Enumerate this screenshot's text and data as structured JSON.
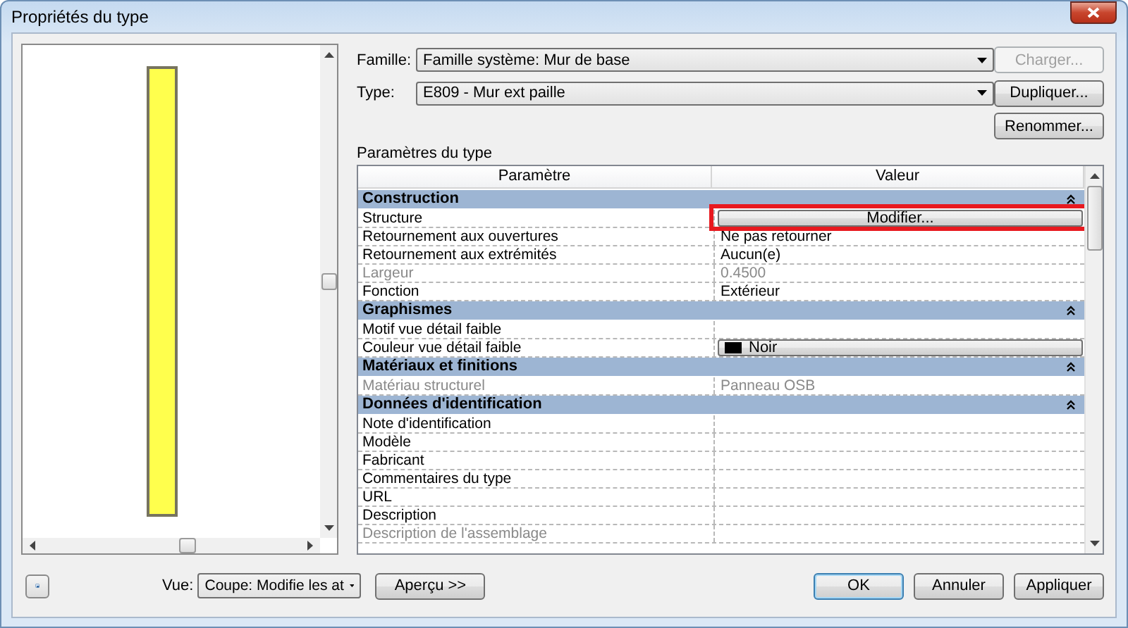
{
  "window": {
    "title": "Propriétés du type"
  },
  "family": {
    "label": "Famille:",
    "value": "Famille système: Mur de base"
  },
  "type": {
    "label": "Type:",
    "value": "E809 - Mur ext paille"
  },
  "side_buttons": [
    {
      "label": "Charger...",
      "disabled": true
    },
    {
      "label": "Dupliquer...",
      "disabled": false
    },
    {
      "label": "Renommer...",
      "disabled": false
    }
  ],
  "section_label": "Paramètres du type",
  "grid": {
    "columns": [
      "Paramètre",
      "Valeur"
    ],
    "rows": [
      {
        "kind": "group",
        "label": "Construction",
        "expanded": true
      },
      {
        "kind": "button",
        "label": "Structure",
        "value": "Modifier...",
        "highlighted": true
      },
      {
        "kind": "text",
        "label": "Retournement aux ouvertures",
        "value": "Ne pas retourner",
        "disabled": false
      },
      {
        "kind": "text",
        "label": "Retournement aux extrémités",
        "value": "Aucun(e)",
        "disabled": false
      },
      {
        "kind": "text",
        "label": "Largeur",
        "value": "0.4500",
        "disabled": true
      },
      {
        "kind": "text",
        "label": "Fonction",
        "value": "Extérieur",
        "disabled": false
      },
      {
        "kind": "group",
        "label": "Graphismes",
        "expanded": true
      },
      {
        "kind": "text",
        "label": "Motif vue détail faible",
        "disabled": false
      },
      {
        "kind": "color",
        "label": "Couleur vue détail faible",
        "value": "Noir",
        "color": "#000000"
      },
      {
        "kind": "group",
        "label": "Matériaux et finitions",
        "expanded": true
      },
      {
        "kind": "text",
        "label": "Matériau structurel",
        "value": "Panneau OSB",
        "disabled": true
      },
      {
        "kind": "group",
        "label": "Données d'identification",
        "expanded": true
      },
      {
        "kind": "text",
        "label": "Note d'identification",
        "disabled": false
      },
      {
        "kind": "text",
        "label": "Modèle",
        "disabled": false
      },
      {
        "kind": "text",
        "label": "Fabricant",
        "disabled": false
      },
      {
        "kind": "text",
        "label": "Commentaires du type",
        "disabled": false
      },
      {
        "kind": "text",
        "label": "URL",
        "disabled": false
      },
      {
        "kind": "text",
        "label": "Description",
        "disabled": false
      },
      {
        "kind": "text",
        "label": "Description de l'assemblage",
        "disabled": true
      }
    ]
  },
  "footer": {
    "view_label": "Vue:",
    "view_value": "Coupe: Modifie les at",
    "preview_button": "Aperçu >>",
    "buttons": [
      {
        "label": "OK",
        "default": true
      },
      {
        "label": "Annuler",
        "default": false
      },
      {
        "label": "Appliquer",
        "default": false
      }
    ]
  }
}
